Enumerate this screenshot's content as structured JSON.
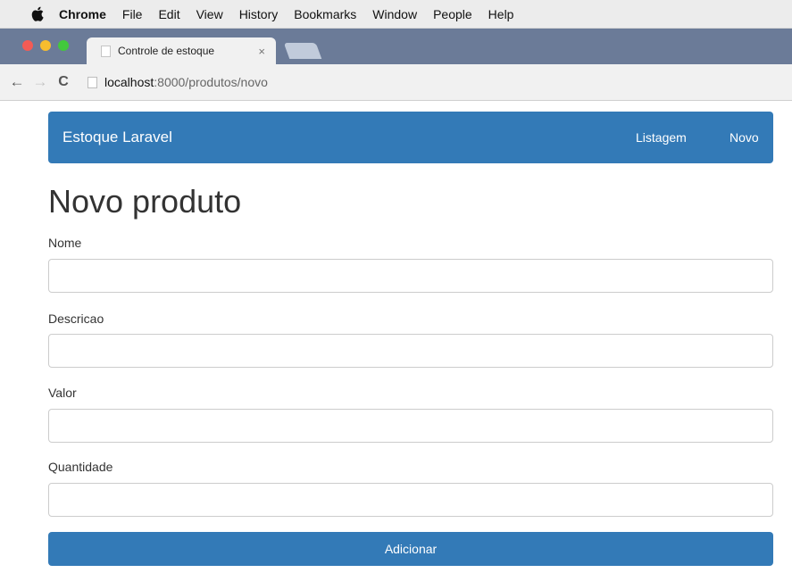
{
  "menubar": {
    "app_name": "Chrome",
    "items": [
      "File",
      "Edit",
      "View",
      "History",
      "Bookmarks",
      "Window",
      "People",
      "Help"
    ]
  },
  "browser": {
    "tab_title": "Controle de estoque",
    "tab_close": "×",
    "url_host": "localhost",
    "url_path": ":8000/produtos/novo"
  },
  "navbar": {
    "brand": "Estoque Laravel",
    "links": [
      "Listagem",
      "Novo"
    ],
    "color": "#337ab7"
  },
  "page": {
    "title": "Novo produto"
  },
  "form": {
    "fields": [
      {
        "label": "Nome",
        "value": ""
      },
      {
        "label": "Descricao",
        "value": ""
      },
      {
        "label": "Valor",
        "value": ""
      },
      {
        "label": "Quantidade",
        "value": ""
      }
    ],
    "submit_label": "Adicionar"
  }
}
